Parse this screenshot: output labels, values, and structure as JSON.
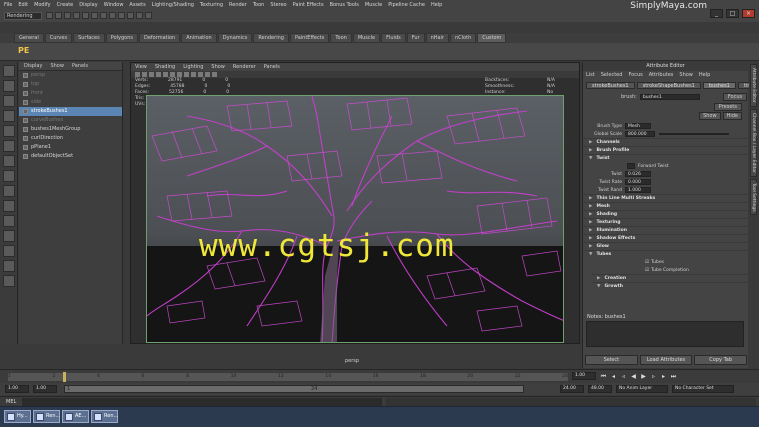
{
  "menubar": {
    "items": [
      "File",
      "Edit",
      "Modify",
      "Create",
      "Display",
      "Window",
      "Assets",
      "Lighting/Shading",
      "Texturing",
      "Render",
      "Toon",
      "Stereo",
      "Paint Effects",
      "Bonus Tools",
      "Muscle",
      "Pipeline Cache",
      "Help"
    ],
    "mode": "Rendering",
    "brand": "SimplyMaya.com"
  },
  "shelf_tabs": [
    "General",
    "Curves",
    "Surfaces",
    "Polygons",
    "Deformation",
    "Animation",
    "Dynamics",
    "Rendering",
    "PaintEffects",
    "Toon",
    "Muscle",
    "Fluids",
    "Fur",
    "nHair",
    "nCloth",
    "Custom"
  ],
  "shelf": {
    "logo": "PE"
  },
  "outliner": {
    "menu": [
      "Display",
      "Show",
      "Panels"
    ],
    "items": [
      {
        "label": "persp",
        "dim": true
      },
      {
        "label": "top",
        "dim": true
      },
      {
        "label": "front",
        "dim": true
      },
      {
        "label": "side",
        "dim": true
      },
      {
        "label": "strokeBushes1",
        "sel": true
      },
      {
        "label": "curveBushes",
        "dim": true
      },
      {
        "label": "bushes1MeshGroup"
      },
      {
        "label": "curlDirection"
      },
      {
        "label": "pPlane1"
      },
      {
        "label": "defaultObjectSet"
      }
    ]
  },
  "viewport": {
    "menu": [
      "View",
      "Shading",
      "Lighting",
      "Show",
      "Renderer",
      "Panels"
    ],
    "hud_left": [
      {
        "k": "Verts:",
        "a": "28791",
        "b": "0",
        "c": "0"
      },
      {
        "k": "Edges:",
        "a": "45788",
        "b": "0",
        "c": "0"
      },
      {
        "k": "Faces:",
        "a": "52756",
        "b": "0",
        "c": "0"
      },
      {
        "k": "Tris:",
        "a": "33760",
        "b": "0",
        "c": "0"
      },
      {
        "k": "UVs:",
        "a": "25976",
        "b": "0",
        "c": "0"
      }
    ],
    "hud_right": [
      {
        "k": "Backfaces:",
        "v": "N/A"
      },
      {
        "k": "Smoothness:",
        "v": "N/A"
      },
      {
        "k": "Instance:",
        "v": "No"
      },
      {
        "k": "Display Layer:",
        "v": "default"
      },
      {
        "k": "Selected Objects:",
        "v": "1"
      },
      {
        "k": "",
        "v": "0.384"
      }
    ],
    "camera": "persp",
    "watermark": "www.cgtsj.com"
  },
  "attribute_editor": {
    "title": "Attribute Editor",
    "menu": [
      "List",
      "Selected",
      "Focus",
      "Attributes",
      "Show",
      "Help"
    ],
    "tabs": [
      "strokeBushes1",
      "strokeShapeBushes1",
      "bushes1",
      "time1"
    ],
    "brush_label": "brush:",
    "brush_value": "bushes1",
    "focus": "Focus",
    "presets": "Presets",
    "show": "Show",
    "hide": "Hide",
    "brush_type_label": "Brush Type",
    "brush_type": "Mesh",
    "global_scale_label": "Global Scale",
    "global_scale": "800.000",
    "sections_top": [
      "Channels",
      "Brush Profile",
      "Twist"
    ],
    "forward_twist": "Forward Twist",
    "twist_label": "Twist",
    "twist": "0.026",
    "twist_rate_label": "Twist Rate",
    "twist_rate": "0.000",
    "twist_rand_label": "Twist Rand",
    "twist_rand": "1.000",
    "sections_mid": [
      "Thin Line Multi Streaks",
      "Mesh",
      "Shading",
      "Texturing",
      "Illumination",
      "Shadow Effects",
      "Glow",
      "Tubes"
    ],
    "tubes_check": "Tubes",
    "tube_completion": "Tube Completion",
    "sections_bottom": [
      "Creation",
      "Growth"
    ],
    "notes_label": "Notes: bushes1",
    "buttons": [
      "Select",
      "Load Attributes",
      "Copy Tab"
    ]
  },
  "side_tabs": [
    "Attribute Editor",
    "Channel Box / Layer Editor",
    "Tool Settings"
  ],
  "time_slider": {
    "ticks": [
      "1",
      "2",
      "4",
      "6",
      "8",
      "10",
      "12",
      "14",
      "16",
      "18",
      "20",
      "22",
      "24"
    ],
    "current": "1.00"
  },
  "range_slider": {
    "start": "1.00",
    "start2": "1.00",
    "bar_label": "1",
    "end_bar": "24",
    "end": "24.00",
    "end2": "48.00",
    "anim_layer": "No Anim Layer",
    "char_set": "No Character Set"
  },
  "command_line": {
    "label": "MEL"
  },
  "taskbar": {
    "tasks": [
      "Hy...",
      "Ren...",
      "AE...",
      "Ren..."
    ]
  }
}
